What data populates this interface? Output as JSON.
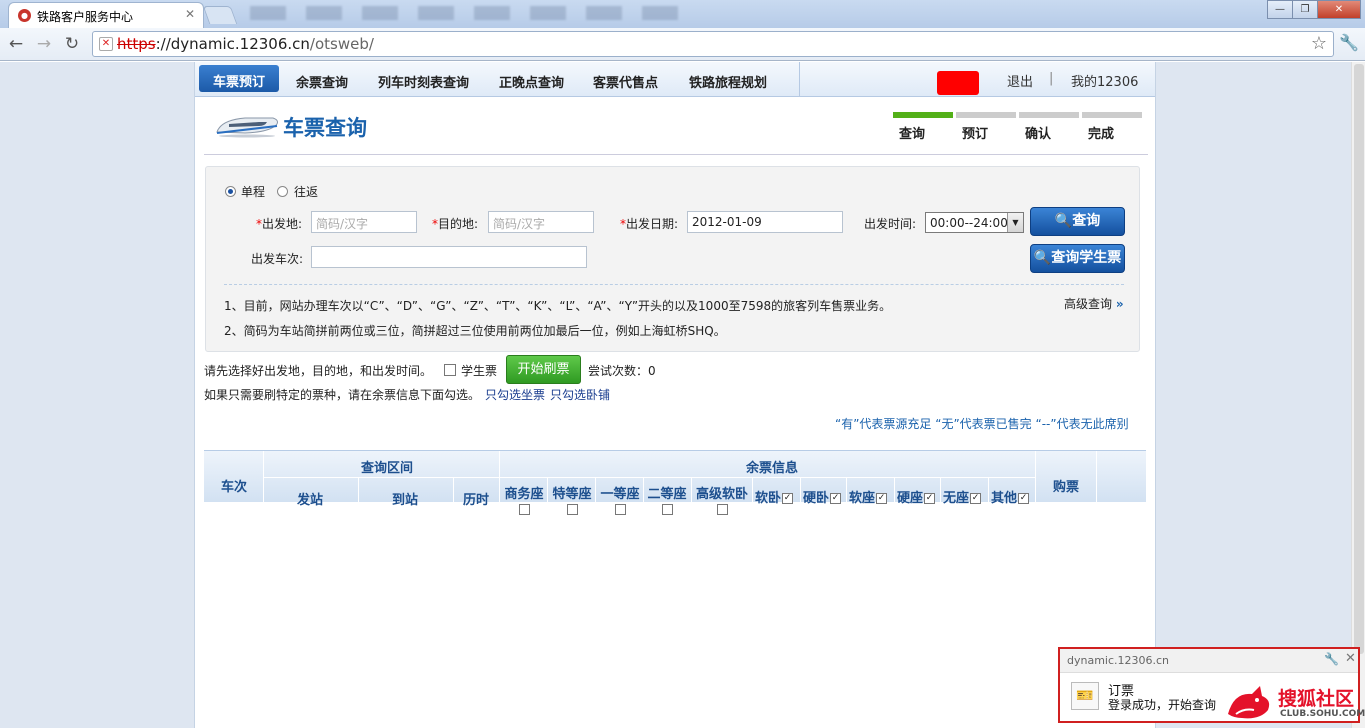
{
  "browser": {
    "tab_title": "铁路客户服务中心",
    "tab_close": "✕",
    "url_scheme": "https",
    "url_host": "://dynamic.12306.cn",
    "url_path": "/otsweb/"
  },
  "nav": {
    "items": [
      "车票预订",
      "余票查询",
      "列车时刻表查询",
      "正晚点查询",
      "客票代售点",
      "铁路旅程规划"
    ],
    "logout": "退出",
    "my": "我的12306"
  },
  "header": {
    "title": "车票查询",
    "steps": [
      "查询",
      "预订",
      "确认",
      "完成"
    ]
  },
  "form": {
    "trip_oneway": "单程",
    "trip_return": "往返",
    "req_mark": "*",
    "from_label": "出发地:",
    "from_placeholder": "简码/汉字",
    "to_label": "目的地:",
    "to_placeholder": "简码/汉字",
    "date_label": "出发日期:",
    "date_value": "2012-01-09",
    "time_label": "出发时间:",
    "time_value": "00:00--24:00",
    "train_label": "出发车次:",
    "search_btn": "查询",
    "student_btn": "查询学生票",
    "notes": [
      "1、目前，网站办理车次以“C”、“D”、“G”、“Z”、“T”、“K”、“L”、“A”、“Y”开头的以及1000至7598的旅客列车售票业务。",
      "2、简码为车站简拼前两位或三位，简拼超过三位使用前两位加最后一位，例如上海虹桥SHQ。"
    ],
    "advanced": "高级查询"
  },
  "refresh": {
    "prompt": "请先选择好出发地，目的地，和出发时间。",
    "student": "学生票",
    "start_btn": "开始刷票",
    "attempts_label": "尝试次数：",
    "attempts_value": "0",
    "hint": "如果只需要刷特定的票种，请在余票信息下面勾选。",
    "link_seat": "只勾选坐票",
    "link_berth": "只勾选卧铺"
  },
  "legend": "“有”代表票源充足  “无”代表票已售完  “--”代表无此席别",
  "table": {
    "col_train": "车次",
    "group_range": "查询区间",
    "group_remaining": "余票信息",
    "col_buy": "购票",
    "range_cols": [
      "发站",
      "到站",
      "历时"
    ],
    "seat_cols_top": [
      "商务座",
      "特等座",
      "一等座",
      "二等座",
      "高级软卧"
    ],
    "seat_cols_inline": [
      "软卧",
      "硬卧",
      "软座",
      "硬座",
      "无座",
      "其他"
    ]
  },
  "notification": {
    "source": "dynamic.12306.cn",
    "title": "订票",
    "body": "登录成功，开始查询"
  },
  "watermark": {
    "text": "搜狐社区",
    "sub": "CLUB.SOHU.COM"
  }
}
